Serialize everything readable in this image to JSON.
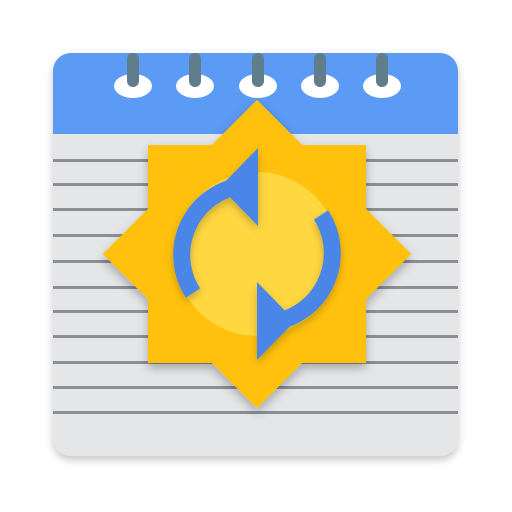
{
  "icon": {
    "name": "notepad-with-sync-badge",
    "elements": [
      "notepad-icon",
      "spiral-binding",
      "sun-badge-icon",
      "sync-arrows-icon"
    ]
  },
  "colors": {
    "header": "#5B9AF5",
    "paper": "#E4E6E8",
    "lines": "#8B8F95",
    "rings": "#607D8B",
    "sun_outer": "#FFC107",
    "sun_inner": "#FFD740",
    "arrows": "#4A86E8"
  }
}
